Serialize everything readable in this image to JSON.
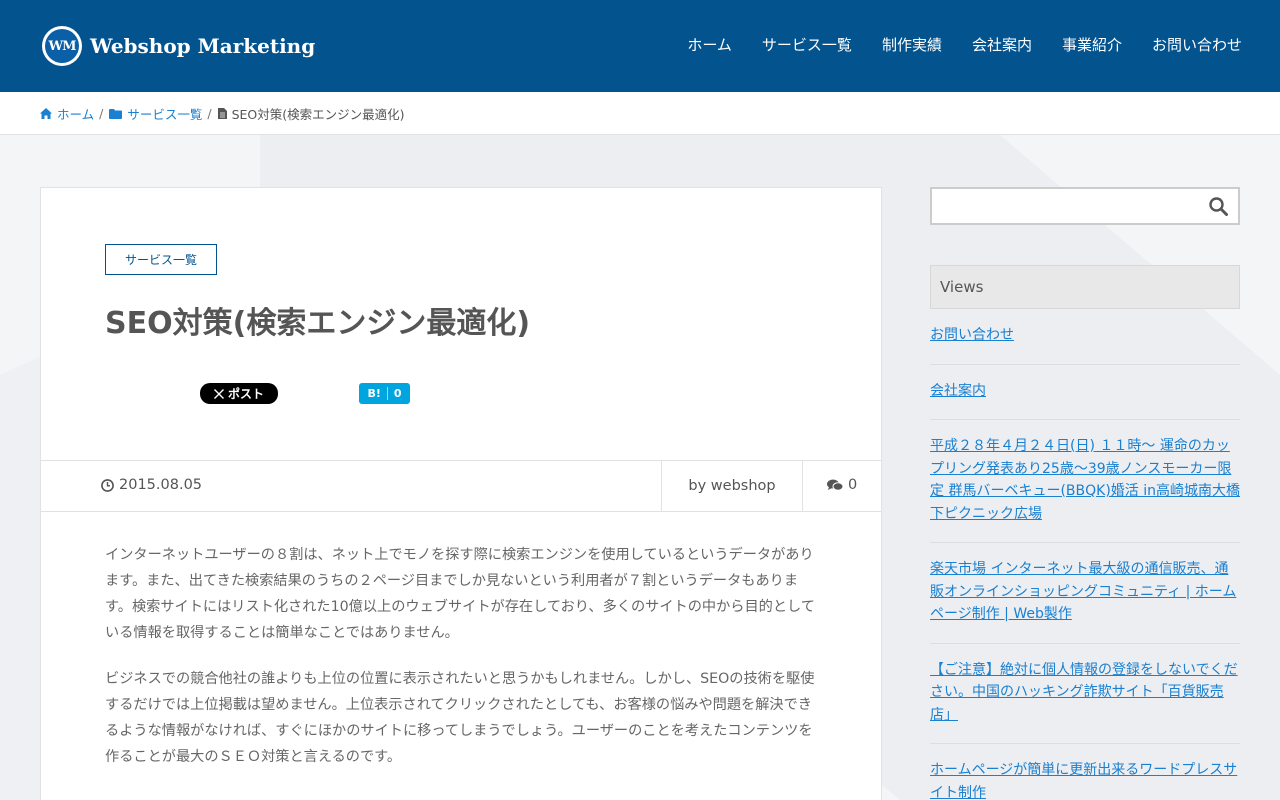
{
  "header": {
    "logo_mark": "WM",
    "logo_text": "Webshop Marketing",
    "nav": [
      "ホーム",
      "サービス一覧",
      "制作実績",
      "会社案内",
      "事業紹介",
      "お問い合わせ"
    ]
  },
  "breadcrumb": {
    "home": "ホーム",
    "sep": "/",
    "category": "サービス一覧",
    "current": "SEO対策(検索エンジン最適化)",
    "home_icon": "home-icon",
    "folder_icon": "folder-icon",
    "file_icon": "file-icon"
  },
  "article": {
    "category": "サービス一覧",
    "title": "SEO対策(検索エンジン最適化)",
    "share_post": "ポスト",
    "share_post_icon": "x-logo-icon",
    "hatena_label": "B!",
    "hatena_count": "0",
    "date": "2015.08.05",
    "author": "by webshop",
    "comments": "0",
    "paragraphs": [
      "インターネットユーザーの８割は、ネット上でモノを探す際に検索エンジンを使用しているというデータがあります。また、出てきた検索結果のうちの２ページ目までしか見ないという利用者が７割というデータもあります。検索サイトにはリスト化された10億以上のウェブサイトが存在しており、多くのサイトの中から目的としている情報を取得することは簡単なことではありません。",
      "ビジネスでの競合他社の誰よりも上位の位置に表示されたいと思うかもしれません。しかし、SEOの技術を駆使するだけでは上位掲載は望めません。上位表示されてクリックされたとしても、お客様の悩みや問題を解決できるような情報がなければ、すぐにほかのサイトに移ってしまうでしょう。ユーザーのことを考えたコンテンツを作ることが最大のＳＥＯ対策と言えるのです。"
    ]
  },
  "sidebar": {
    "search_placeholder": "",
    "widget_title": "Views",
    "links": [
      "お問い合わせ",
      "会社案内",
      "平成２８年４月２４日(日) １１時〜 運命のカップリング発表あり25歳〜39歳ノンスモーカー限定 群馬バーベキュー(BBQK)婚活 in高崎城南大橋下ピクニック広場",
      "楽天市場 インターネット最大級の通信販売、通販オンラインショッピングコミュニティ | ホームページ制作 | Web製作",
      "【ご注意】絶対に個人情報の登録をしないでください。中国のハッキング詐欺サイト「百貨販売店」",
      "ホームページが簡単に更新出来るワードプレスサイト制作"
    ]
  },
  "colors": {
    "header_bg": "#03538f",
    "link": "#1a80d1",
    "hatena": "#00a4de"
  }
}
